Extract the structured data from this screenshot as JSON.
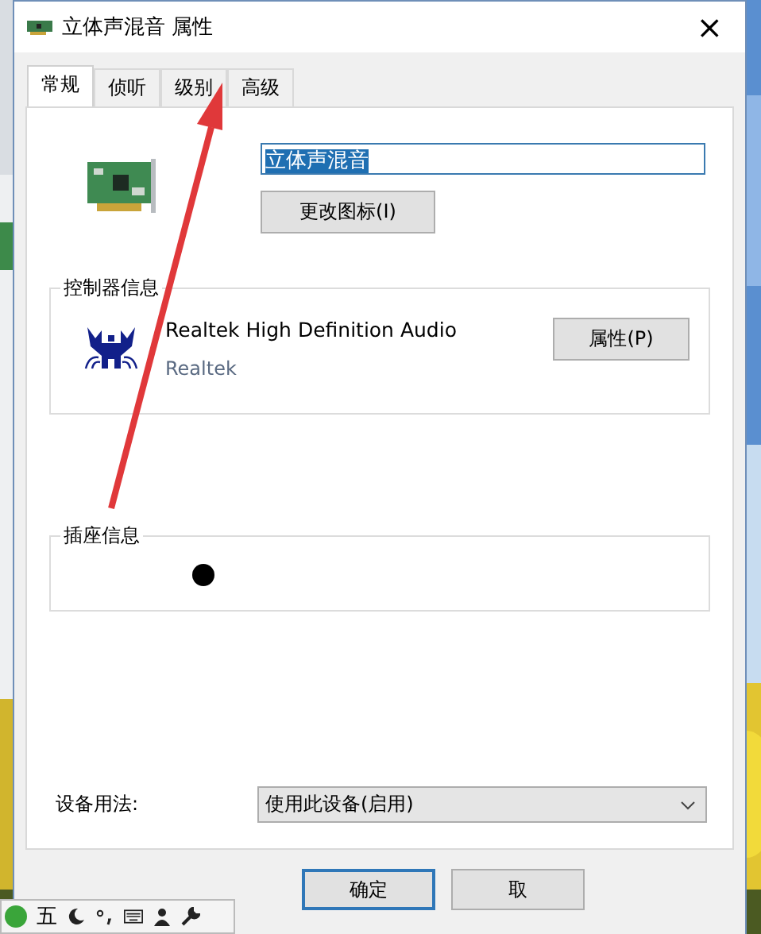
{
  "window": {
    "title": "立体声混音 属性",
    "close": "×"
  },
  "tabs": [
    {
      "label": "常规",
      "selected": true
    },
    {
      "label": "侦听",
      "selected": false
    },
    {
      "label": "级别",
      "selected": false
    },
    {
      "label": "高级",
      "selected": false
    }
  ],
  "device": {
    "name": "立体声混音",
    "text_selected": true,
    "change_icon_button": "更改图标(I)"
  },
  "controller": {
    "heading": "控制器信息",
    "name": "Realtek High Definition Audio",
    "vendor": "Realtek",
    "properties_button": "属性(P)"
  },
  "jack": {
    "heading": "插座信息"
  },
  "usage": {
    "label": "设备用法:",
    "value": "使用此设备(启用)"
  },
  "buttons": [
    {
      "label": "确定",
      "default": true
    },
    {
      "label": "取",
      "default": false
    }
  ],
  "ime_bar": {
    "mode": "五"
  }
}
